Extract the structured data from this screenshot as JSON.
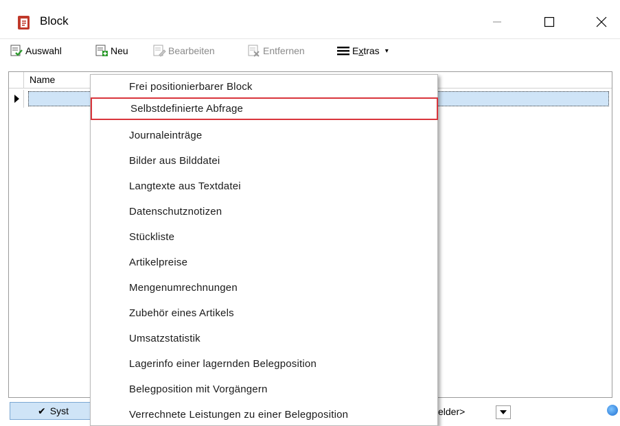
{
  "window": {
    "title": "Block",
    "icon": "block-app-icon",
    "controls": {
      "minimize": "—",
      "maximize": "☐",
      "close": "✕"
    }
  },
  "toolbar": {
    "auswahl_label": "Auswahl",
    "neu_label": "Neu",
    "bearbeiten_label": "Bearbeiten",
    "entfernen_label": "Entfernen",
    "extras_prefix": "E",
    "extras_underlined": "x",
    "extras_suffix": "tras",
    "extras_arrow": "▾"
  },
  "grid": {
    "columns": [
      "Name"
    ],
    "rows": [
      {
        "name": ""
      }
    ]
  },
  "statusbar": {
    "system_button": "Syst",
    "system_check": "✔",
    "felder_label": "elder>"
  },
  "menu": {
    "items": [
      "Frei positionierbarer Block",
      "Selbstdefinierte Abfrage",
      "Journaleinträge",
      "Bilder aus Bilddatei",
      "Langtexte aus Textdatei",
      "Datenschutznotizen",
      "Stückliste",
      "Artikelpreise",
      "Mengenumrechnungen",
      "Zubehör eines Artikels",
      "Umsatzstatistik",
      "Lagerinfo einer lagernden Belegposition",
      "Belegposition mit Vorgängern",
      "Verrechnete Leistungen zu einer Belegposition"
    ],
    "highlighted_index": 1
  },
  "colors": {
    "selection": "#cfe4f7",
    "highlight_border": "#d9343b",
    "app_icon": "#c0392b"
  }
}
